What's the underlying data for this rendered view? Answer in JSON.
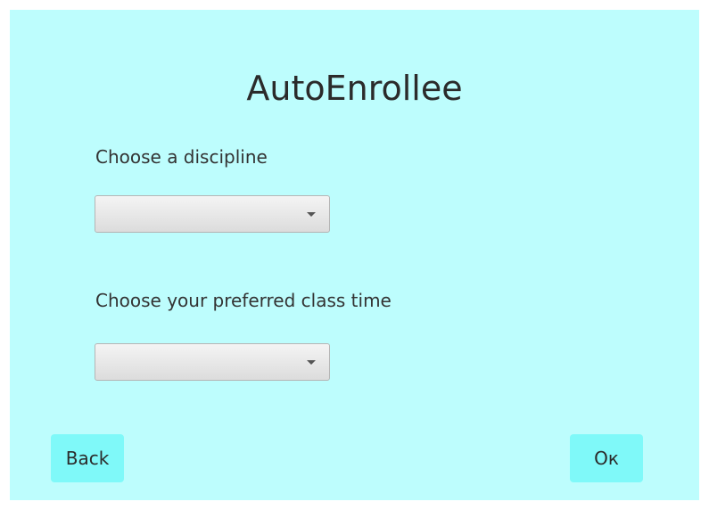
{
  "app": {
    "title": "AutoEnrollee"
  },
  "form": {
    "discipline_label": "Choose a discipline",
    "discipline_value": "",
    "time_label": "Choose your preferred class time",
    "time_value": ""
  },
  "buttons": {
    "back_label": "Back",
    "ok_label": "Oк"
  },
  "colors": {
    "background": "#bdfdfd",
    "button": "#7ff9f9"
  },
  "icons": {
    "dropdown_arrow": "chevron-down-icon"
  }
}
